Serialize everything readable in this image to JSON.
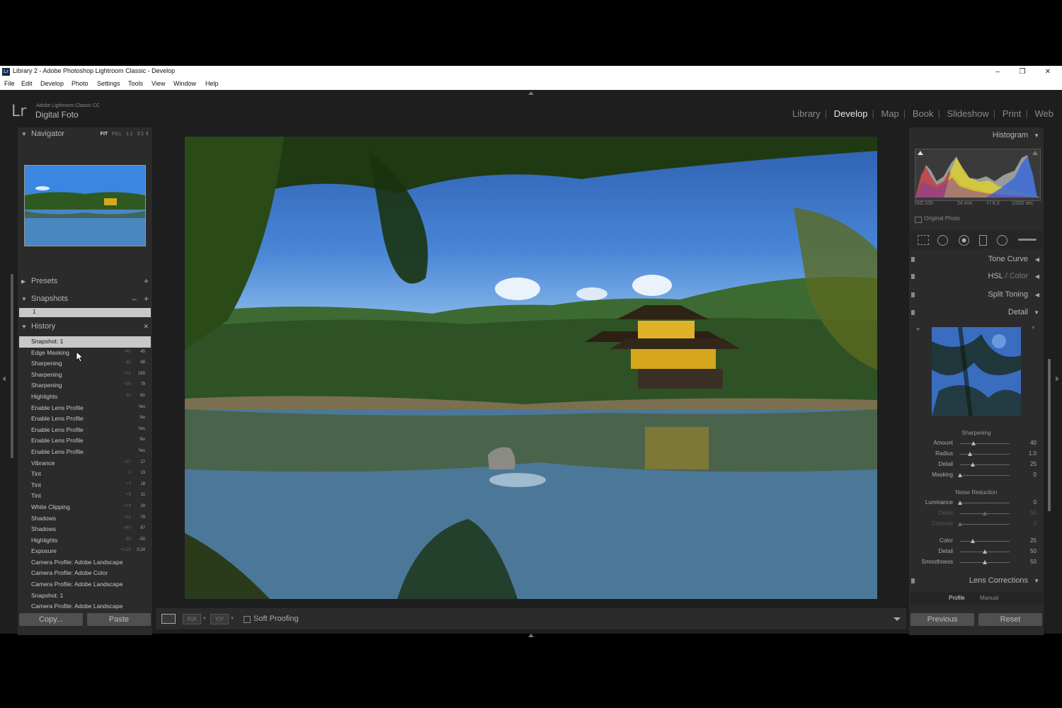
{
  "window": {
    "title": "Library 2 - Adobe Photoshop Lightroom Classic - Develop",
    "app_icon_text": "Lr",
    "minimize": "–",
    "restore": "❐",
    "close": "✕"
  },
  "menu": [
    "File",
    "Edit",
    "Develop",
    "Photo",
    "Settings",
    "Tools",
    "View",
    "Window",
    "Help"
  ],
  "brand": {
    "logo": "Lr",
    "line1": "Adobe Lightroom Classic CC",
    "line2": "Digital Foto"
  },
  "modules": {
    "items": [
      "Library",
      "Develop",
      "Map",
      "Book",
      "Slideshow",
      "Print",
      "Web"
    ],
    "active": "Develop",
    "separator": "|"
  },
  "navigator": {
    "title": "Navigator",
    "options": [
      "FIT",
      "FILL",
      "1:1",
      "3:1"
    ],
    "active_option": "FIT"
  },
  "presets": {
    "title": "Presets",
    "add": "+"
  },
  "snapshots": {
    "title": "Snapshots",
    "remove": "–",
    "add": "+",
    "items": [
      "1"
    ]
  },
  "history": {
    "title": "History",
    "clear": "✕",
    "items": [
      {
        "name": "Snapshot: 1",
        "a": "",
        "b": "",
        "selected": true
      },
      {
        "name": "Edge Masking",
        "a": "+45",
        "b": "45"
      },
      {
        "name": "Sharpening",
        "a": "-82",
        "b": "68"
      },
      {
        "name": "Sharpening",
        "a": "+71",
        "b": "150"
      },
      {
        "name": "Sharpening",
        "a": "+39",
        "b": "79"
      },
      {
        "name": "Highlights",
        "a": "-31",
        "b": "-81"
      },
      {
        "name": "Enable Lens Profile",
        "a": "",
        "b": "Yes"
      },
      {
        "name": "Enable Lens Profile",
        "a": "",
        "b": "No"
      },
      {
        "name": "Enable Lens Profile",
        "a": "",
        "b": "Yes"
      },
      {
        "name": "Enable Lens Profile",
        "a": "",
        "b": "No"
      },
      {
        "name": "Enable Lens Profile",
        "a": "",
        "b": "Yes"
      },
      {
        "name": "Vibrance",
        "a": "+17",
        "b": "17"
      },
      {
        "name": "Tint",
        "a": "-5",
        "b": "13"
      },
      {
        "name": "Tint",
        "a": "+7",
        "b": "18"
      },
      {
        "name": "Tint",
        "a": "+5",
        "b": "11"
      },
      {
        "name": "White Clipping",
        "a": "+19",
        "b": "19"
      },
      {
        "name": "Shadows",
        "a": "+12",
        "b": "79"
      },
      {
        "name": "Shadows",
        "a": "+67",
        "b": "67"
      },
      {
        "name": "Highlights",
        "a": "-50",
        "b": "-50"
      },
      {
        "name": "Exposure",
        "a": "+0.24",
        "b": "0.24"
      },
      {
        "name": "Camera Profile: Adobe Landscape",
        "a": "",
        "b": ""
      },
      {
        "name": "Camera Profile: Adobe Color",
        "a": "",
        "b": ""
      },
      {
        "name": "Camera Profile: Adobe Landscape",
        "a": "",
        "b": ""
      },
      {
        "name": "Snapshot: 1",
        "a": "",
        "b": ""
      },
      {
        "name": "Camera Profile: Adobe Landscape",
        "a": "",
        "b": ""
      }
    ]
  },
  "left_buttons": {
    "copy": "Copy...",
    "paste": "Paste"
  },
  "toolbar": {
    "soft_proofing": "Soft Proofing",
    "ra": "R|A",
    "yy": "Y|Y"
  },
  "histogram": {
    "title": "Histogram",
    "iso": "ISO 100",
    "focal": "24 mm",
    "aperture": "f / 6.3",
    "shutter": "1/320 sec",
    "original_photo": "Original Photo"
  },
  "panels": {
    "tone_curve": "Tone Curve",
    "hsl": "HSL",
    "hsl_sep": " / ",
    "color": "Color",
    "split_toning": "Split Toning",
    "detail": "Detail",
    "lens_corrections": "Lens Corrections"
  },
  "sharpening": {
    "title": "Sharpening",
    "sliders": [
      {
        "name": "Amount",
        "value": "40",
        "pos": 0.27
      },
      {
        "name": "Radius",
        "value": "1.0",
        "pos": 0.2
      },
      {
        "name": "Detail",
        "value": "25",
        "pos": 0.25
      },
      {
        "name": "Masking",
        "value": "0",
        "pos": 0.0
      }
    ]
  },
  "noise_reduction": {
    "title": "Noise Reduction",
    "sliders": [
      {
        "name": "Luminance",
        "value": "0",
        "pos": 0.0,
        "disabled": false
      },
      {
        "name": "Detail",
        "value": "50",
        "pos": 0.5,
        "disabled": true
      },
      {
        "name": "Contrast",
        "value": "0",
        "pos": 0.0,
        "disabled": true
      },
      {
        "name": "Color",
        "value": "25",
        "pos": 0.25,
        "disabled": false
      },
      {
        "name": "Detail",
        "value": "50",
        "pos": 0.5,
        "disabled": false
      },
      {
        "name": "Smoothness",
        "value": "50",
        "pos": 0.5,
        "disabled": false
      }
    ]
  },
  "lens_tabs": [
    "Profile",
    "Manual"
  ],
  "right_buttons": {
    "previous": "Previous",
    "reset": "Reset"
  }
}
